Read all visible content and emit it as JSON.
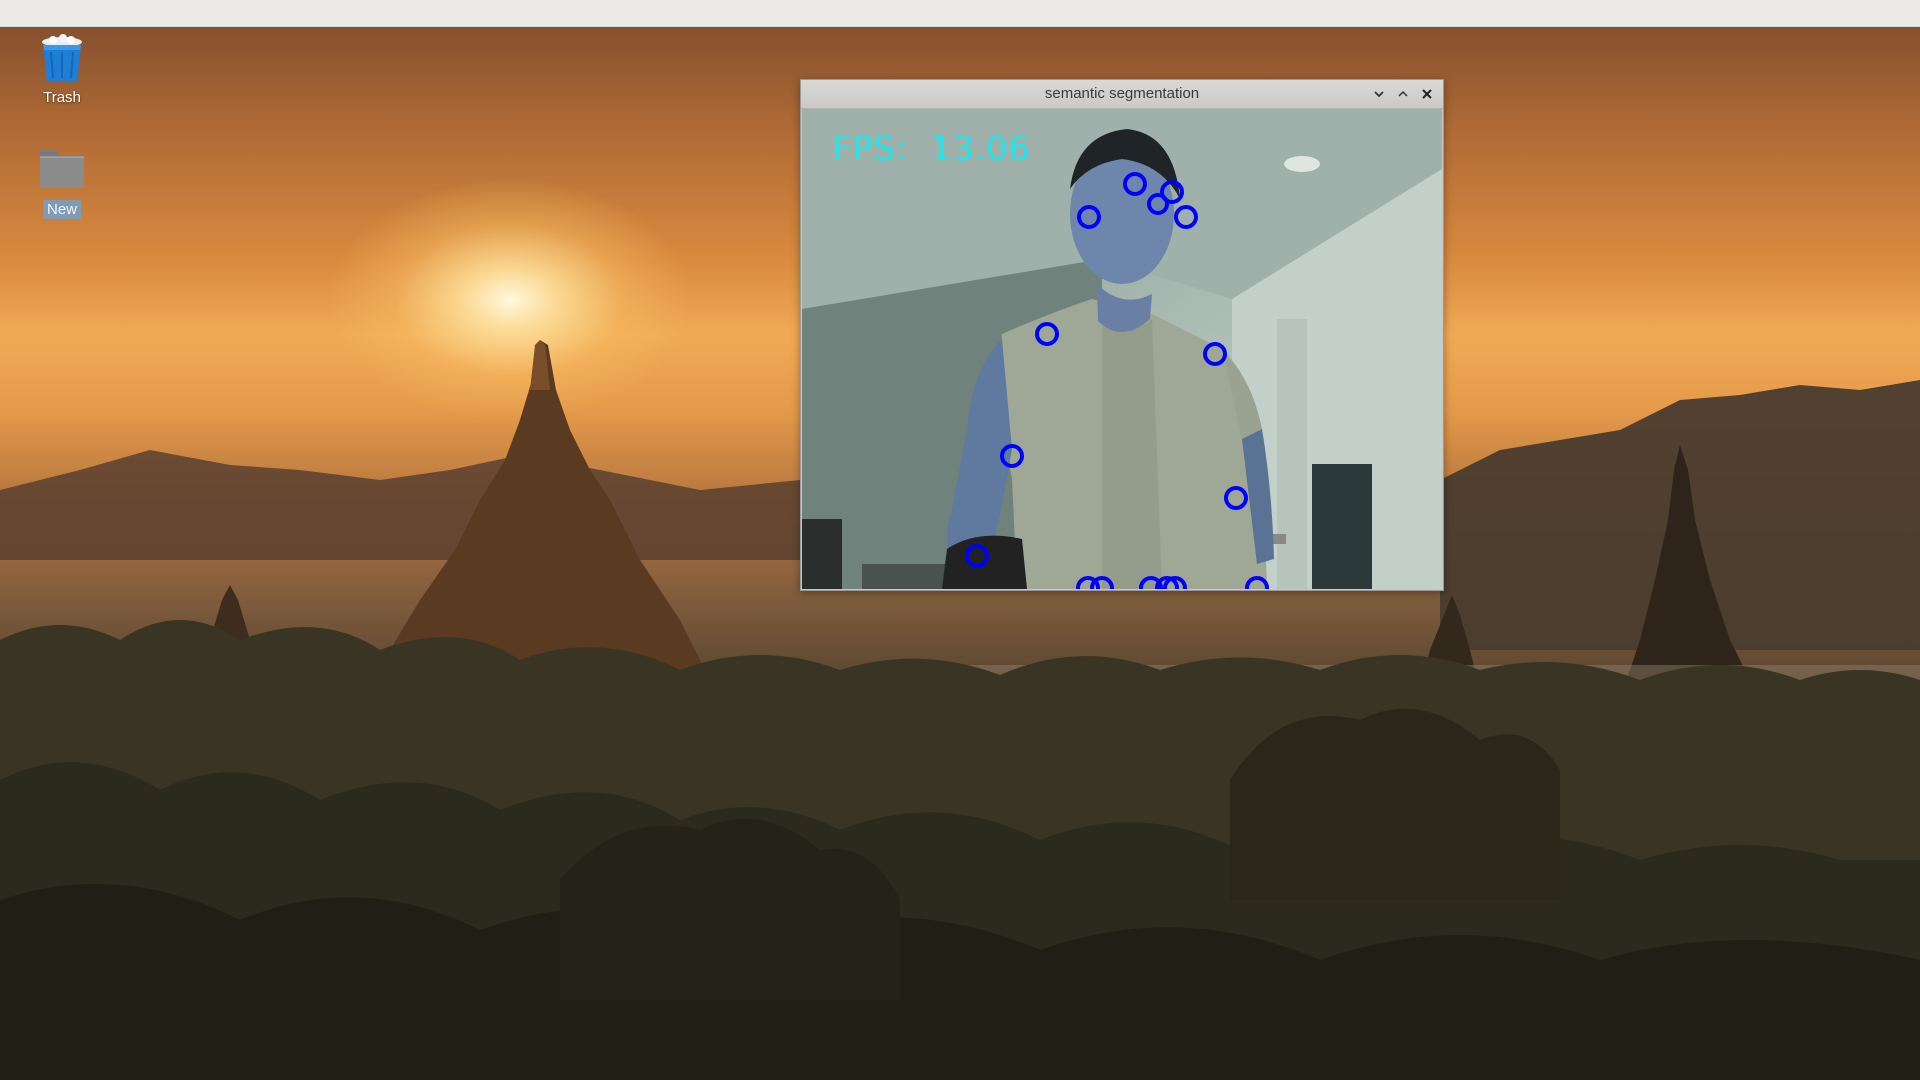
{
  "desktop": {
    "icons": [
      {
        "label": "Trash",
        "icon": "trash-icon"
      },
      {
        "label": "New",
        "icon": "folder-icon"
      }
    ]
  },
  "window": {
    "title": "semantic segmentation",
    "buttons": [
      "chevron-down-icon",
      "chevron-up-icon",
      "close-icon"
    ],
    "overlay": {
      "fps_label": "FPS:",
      "fps_value": "13.06",
      "fps_color": "#22e6ea",
      "keypoint_color": "#0000ff",
      "keypoint_count": 20
    }
  },
  "colors": {
    "taskbar": "#ebeae8",
    "titlebar": "#d0d0ce",
    "trash_blue": "#1f7fd6",
    "folder_gray": "#8c8c8c"
  }
}
